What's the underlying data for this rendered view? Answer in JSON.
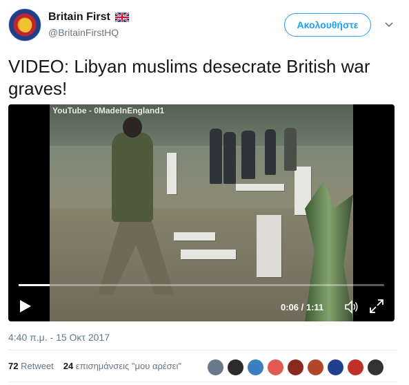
{
  "header": {
    "name": "Britain First",
    "handle": "@BritainFirstHQ",
    "follow_label": "Ακολουθήστε",
    "flag_icon": "uk-flag-icon",
    "chevron_icon": "chevron-down-icon"
  },
  "tweet": {
    "text": "VIDEO: Libyan muslims desecrate British war graves!"
  },
  "video": {
    "watermark": "YouTube - 0MadeInEngland1",
    "time": "0:06 / 1:11",
    "progress": 0.084,
    "play_icon": "play-icon",
    "volume_icon": "volume-icon",
    "fullscreen_icon": "fullscreen-icon"
  },
  "meta": {
    "timestamp": "4:40 π.μ. - 15 Οκτ 2017"
  },
  "stats": {
    "retweets_count": "72",
    "retweets_label": "Retweet",
    "likes_count": "24",
    "likes_label": "επισημάνσεις \"μου αρέσει\""
  },
  "likers": [
    {
      "color": "#6b7a8a"
    },
    {
      "color": "#2b2b2b"
    },
    {
      "color": "#3a7fc0"
    },
    {
      "color": "#e05a4f"
    },
    {
      "color": "#8a2a1e"
    },
    {
      "color": "#b0462c"
    },
    {
      "color": "#1f3f8f"
    },
    {
      "color": "#c03028"
    },
    {
      "color": "#333333"
    }
  ],
  "colors": {
    "accent": "#1da1f2",
    "muted": "#657786",
    "text": "#14171a"
  }
}
